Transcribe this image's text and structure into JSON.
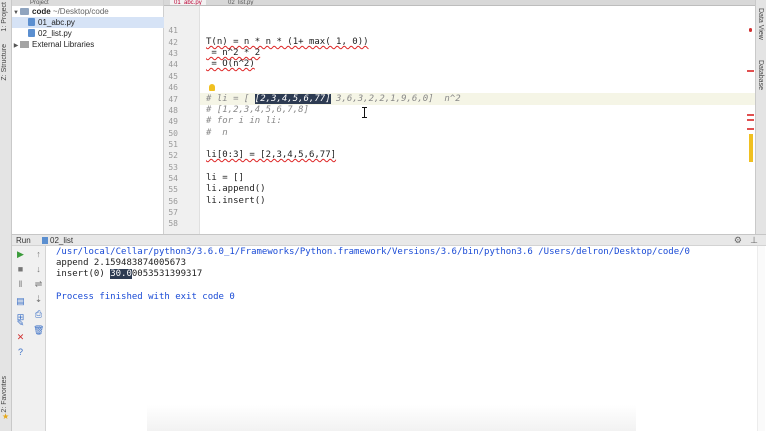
{
  "project": {
    "header": "Project",
    "items": [
      {
        "label": "code",
        "path": "~/Desktop/code"
      },
      {
        "label": "01_abc.py"
      },
      {
        "label": "02_list.py"
      },
      {
        "label": "External Libraries"
      }
    ]
  },
  "left_tabs": {
    "project": "1: Project",
    "structure": "Z: Structure",
    "favorites": "2: Favorites"
  },
  "right_tabs": {
    "data_view": "Data View",
    "database": "Database"
  },
  "editor_tabs": [
    "01_abc.py",
    "02_list.py"
  ],
  "editor": {
    "line_numbers": [
      "41",
      "42",
      "43",
      "44",
      "45",
      "46",
      "47",
      "48",
      "49",
      "50",
      "51",
      "52",
      "53",
      "54",
      "55",
      "56",
      "57",
      "58"
    ],
    "line42": "T(n) = n * n * (1+ max( 1, 0))",
    "line43": " = n^2 * 2",
    "line44": " = O(n^2)",
    "line47_prefix": "# li = [ ",
    "line47_selected": "[2,3,4,5,6,77]",
    "line47_suffix": " 3,6,3,2,2,1,9,6,0]  n^2",
    "line48": "# [1,2,3,4,5,6,7,8]",
    "line49": "# for i in li:",
    "line50": "#  n",
    "line52": "li[0:3] = [2,3,4,5,6,77]",
    "line54": "li = []",
    "line55": "li.append()",
    "line56": "li.insert()"
  },
  "run": {
    "title": "Run",
    "tab": "02_list",
    "console": {
      "command": "/usr/local/Cellar/python3/3.6.0_1/Frameworks/Python.framework/Versions/3.6/bin/python3.6 /Users/delron/Desktop/code/0",
      "append_line": "append 2.159483874005673",
      "insert_label": "insert(0) ",
      "insert_selected": "30.0",
      "insert_rest": "0053531399317",
      "finished": "Process finished with exit code 0"
    }
  },
  "colors": {
    "selection_bg": "#2d3b52",
    "console_blue": "#1a4bd6",
    "error_marker": "#e05050"
  }
}
